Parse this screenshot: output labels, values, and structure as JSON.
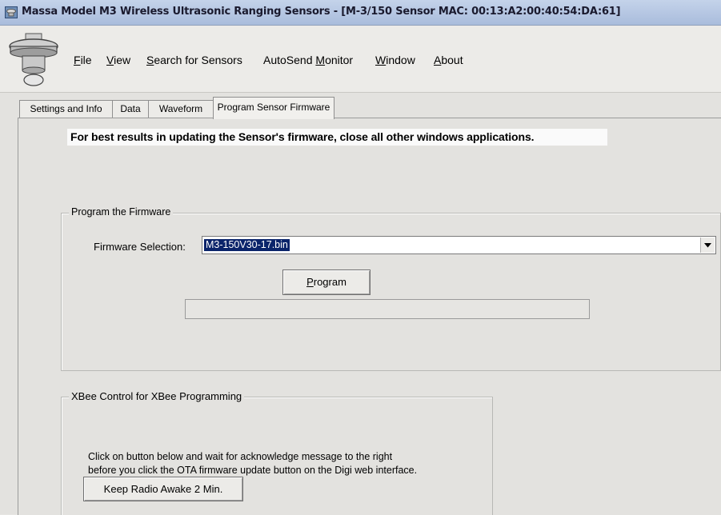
{
  "window": {
    "title": "Massa Model M3 Wireless Ultrasonic Ranging Sensors - [M-3/150 Sensor   MAC: 00:13:A2:00:40:54:DA:61]",
    "app_icon": "sensor-icon"
  },
  "menu": {
    "items": [
      {
        "mnemonic": "F",
        "rest": "ile"
      },
      {
        "mnemonic": "V",
        "rest": "iew"
      },
      {
        "mnemonic": "S",
        "rest": "earch for Sensors"
      },
      {
        "pre": "AutoSend ",
        "mnemonic": "M",
        "rest": "onitor"
      },
      {
        "mnemonic": "W",
        "rest": "indow"
      },
      {
        "mnemonic": "A",
        "rest": "bout"
      }
    ]
  },
  "tabs": [
    {
      "label": "Settings and Info"
    },
    {
      "label": "Data"
    },
    {
      "label": "Waveform"
    },
    {
      "label": "Program Sensor Firmware",
      "active": true
    }
  ],
  "notice": "For best results in updating the Sensor's firmware, close all other windows applications.",
  "program_group": {
    "title": "Program the Firmware",
    "firmware_label": "Firmware Selection:",
    "firmware_value": "M3-150V30-17.bin",
    "program_button": {
      "mnemonic": "P",
      "rest": "rogram"
    },
    "progress_value": 0
  },
  "xbee_group": {
    "title": "XBee Control for XBee Programming",
    "instruction_line1": "Click on button below and wait for acknowledge message to the right",
    "instruction_line2": "before you click the OTA firmware update button on the Digi web interface.",
    "awake_button": "Keep Radio Awake 2 Min."
  },
  "colors": {
    "titlebar": "#a9bcdc",
    "selection": "#0a246a",
    "progress": "#3a8ee6"
  }
}
